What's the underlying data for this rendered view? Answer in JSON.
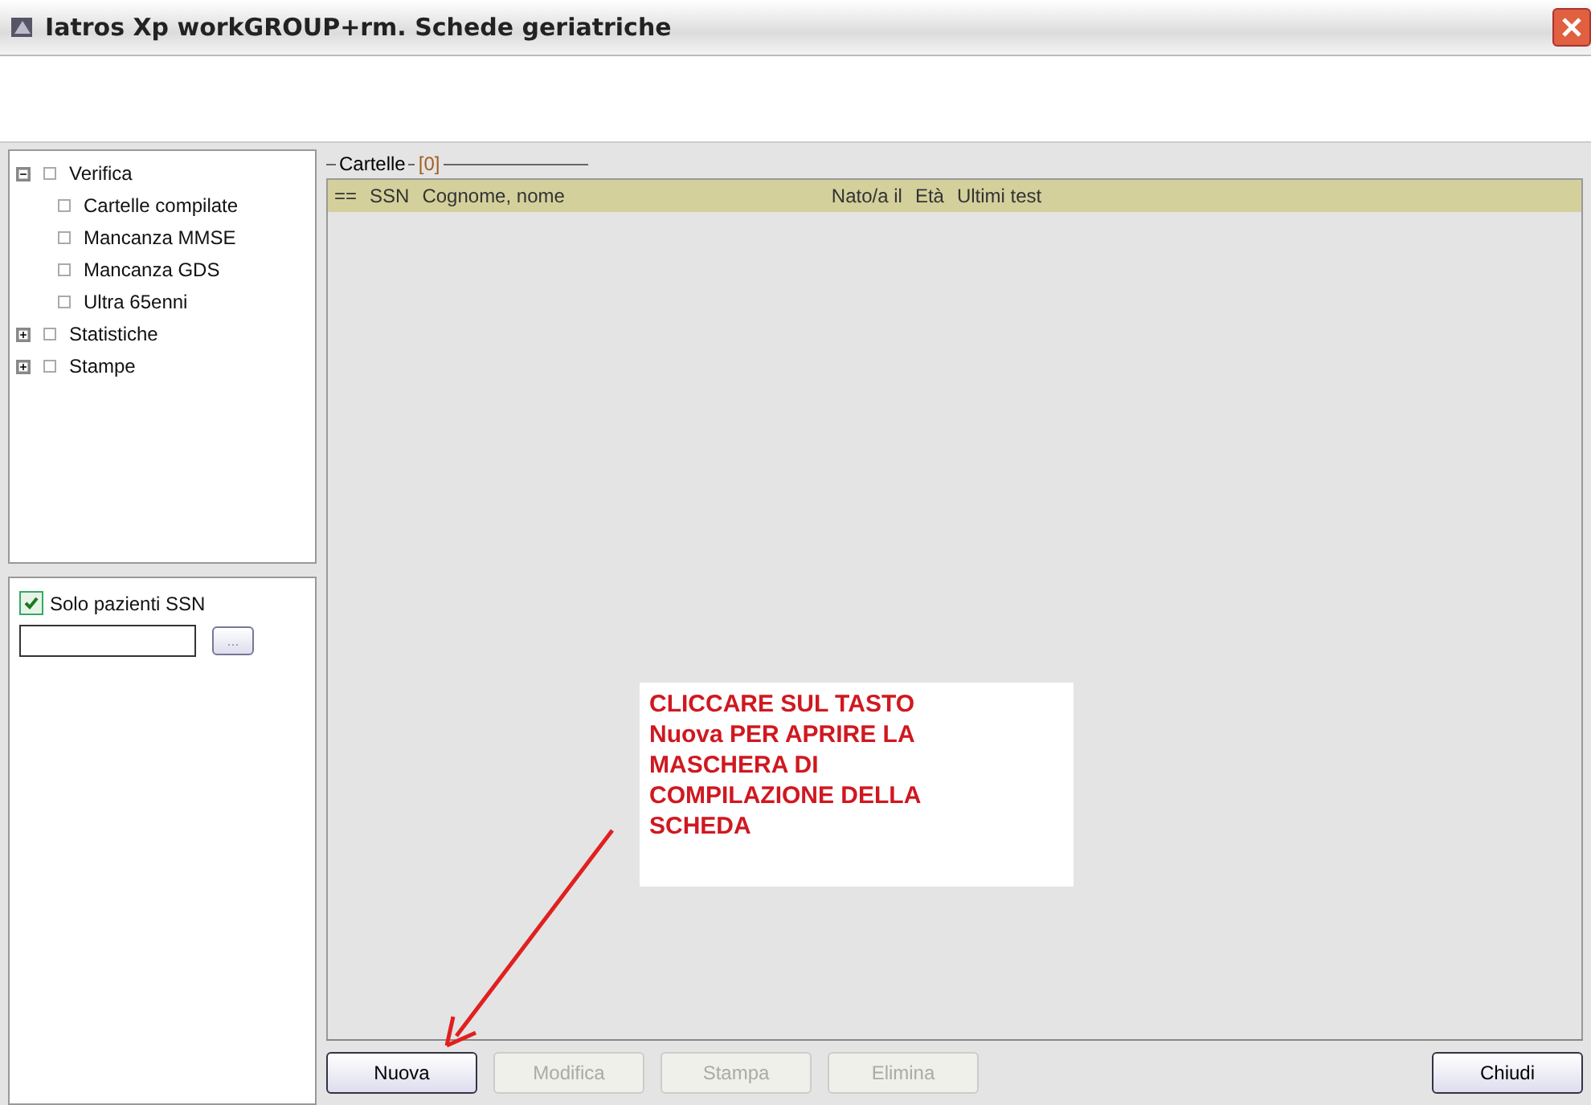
{
  "window": {
    "title": "Iatros Xp workGROUP+rm. Schede geriatriche"
  },
  "tree": [
    {
      "label": "Verifica",
      "expanded": true,
      "children": [
        {
          "label": "Cartelle compilate"
        },
        {
          "label": "Mancanza MMSE"
        },
        {
          "label": "Mancanza GDS"
        },
        {
          "label": "Ultra 65enni"
        }
      ]
    },
    {
      "label": "Statistiche",
      "expanded": false
    },
    {
      "label": "Stampe",
      "expanded": false
    }
  ],
  "filter": {
    "checkbox": {
      "label": "Solo pazienti SSN",
      "checked": true
    },
    "browse_button": "..."
  },
  "group": {
    "title": "Cartelle",
    "count": "[0]"
  },
  "table": {
    "columns": [
      "==",
      "SSN",
      "Cognome, nome",
      "Nato/a il",
      "Età",
      "Ultimi test"
    ]
  },
  "annotation": "CLICCARE SUL TASTO Nuova PER APRIRE LA MASCHERA DI COMPILAZIONE DELLA SCHEDA",
  "buttons": [
    {
      "label": "Nuova",
      "disabled": false
    },
    {
      "label": "Modifica",
      "disabled": true
    },
    {
      "label": "Stampa",
      "disabled": true
    },
    {
      "label": "Elimina",
      "disabled": true
    }
  ],
  "close_button": "Chiudi"
}
